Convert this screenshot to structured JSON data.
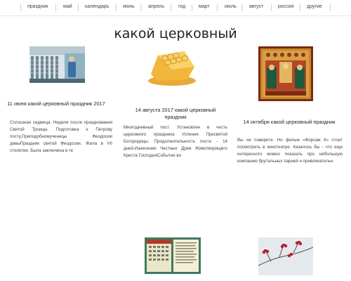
{
  "nav": {
    "items": [
      "праздник",
      "май",
      "календарь",
      "июнь",
      "апрель",
      "год",
      "март",
      "июль",
      "август",
      "россия",
      "другие"
    ]
  },
  "page": {
    "title": "какой церковный"
  },
  "articles": [
    {
      "title": "11 июня какой церковный праздник 2017",
      "excerpt": "Сплошная седмица. Неделя после празднования Святой Троицы. Подготовка к Петрову посту.Преподобномученицы Феодосии девыПраздник святой Феодосии. Жила в VII столетии. Была заключена в те"
    },
    {
      "title": "14 августа 2017 какой церковный праздник",
      "excerpt": "Многодневный пост. Установлен в честь церковного праздника Успения Пресвятой Богородицы. Продолжительность поста - 14 дней.Изнесение Честных Древ Животворящего Креста ГосподняСобытие во"
    },
    {
      "title": "14 октября какой церковный праздник",
      "excerpt": "Вы не поверите. Но фильм «Форсаж 8» стоит посмотреть в кинотеатре. Казалось бы - что еще интересного можно показать про небольшую компанию брутальных парней и привлекательн"
    }
  ],
  "colors": {
    "accent": "#c0392b",
    "text": "#222222",
    "muted": "#444444",
    "divider": "#cfcfcf"
  }
}
